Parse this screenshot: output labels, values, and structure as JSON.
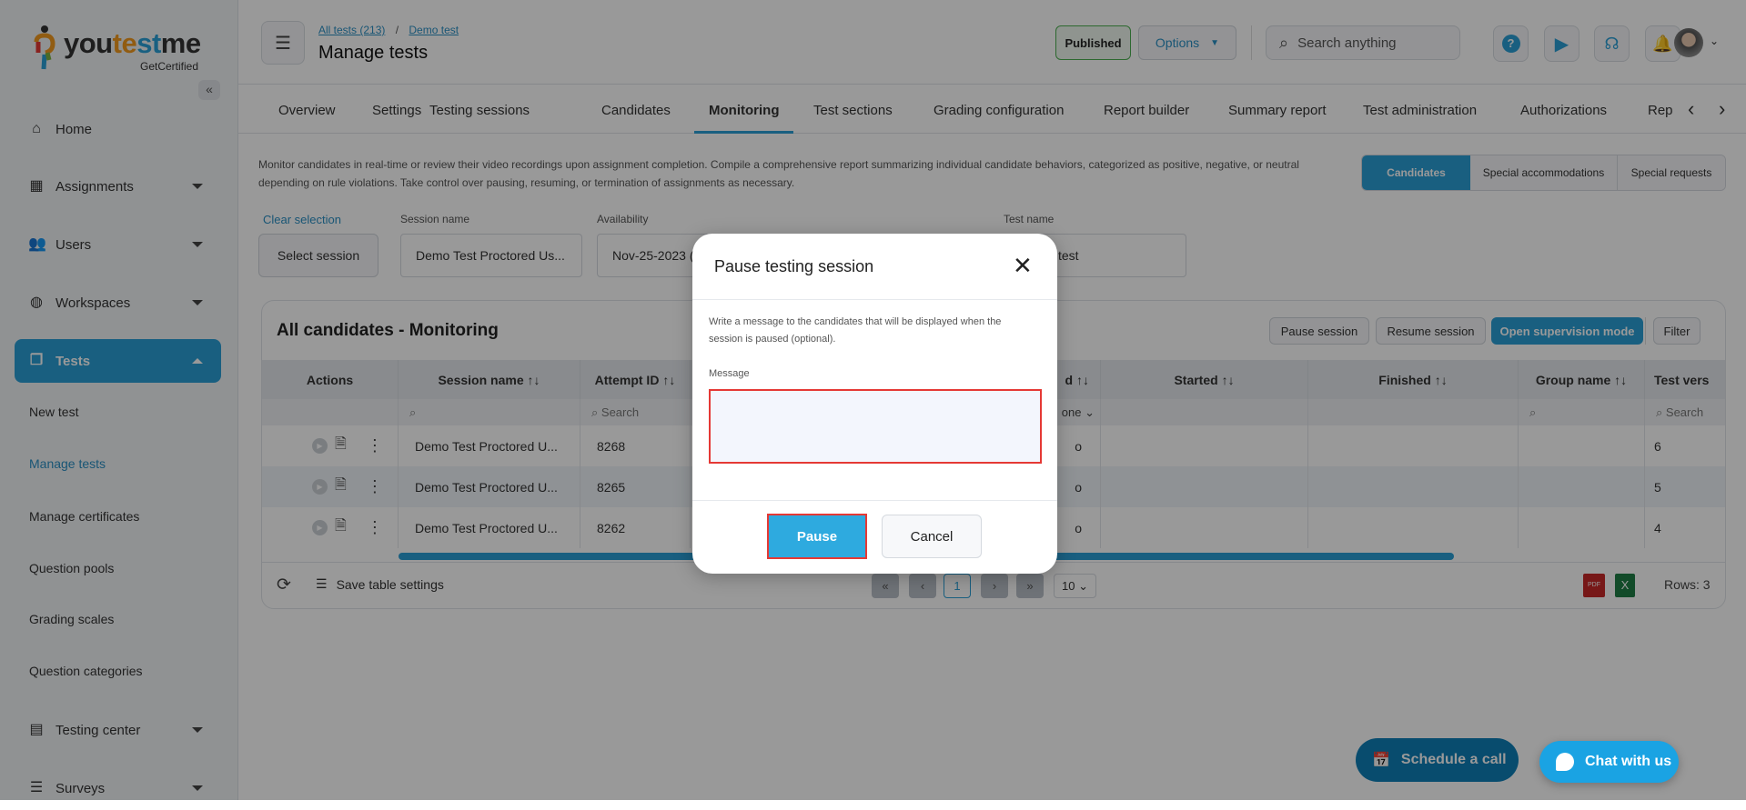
{
  "brand": {
    "name_parts": [
      "you",
      "te",
      "st",
      "me"
    ],
    "tagline": "GetCertified"
  },
  "colors": {
    "primary": "#2b9fd6",
    "published_border": "#4caf50",
    "highlight": "#e53935"
  },
  "sidebar": {
    "collapse_icon": "double-chevron-left-icon",
    "items": [
      {
        "label": "Home",
        "icon": "home-icon"
      },
      {
        "label": "Assignments",
        "icon": "dashboard-icon"
      },
      {
        "label": "Users",
        "icon": "users-icon"
      },
      {
        "label": "Workspaces",
        "icon": "globe-icon"
      },
      {
        "label": "Tests",
        "icon": "copy-icon",
        "active": true
      },
      {
        "label": "Testing center",
        "icon": "calendar-card-icon"
      },
      {
        "label": "Surveys",
        "icon": "list-icon"
      }
    ],
    "tests_sub": [
      "New test",
      "Manage tests",
      "Manage certificates",
      "Question pools",
      "Grading scales",
      "Question categories"
    ],
    "active_sub": "Manage tests"
  },
  "header": {
    "breadcrumb": [
      "All tests (213)",
      "Demo test"
    ],
    "separator": "/",
    "title": "Manage tests",
    "status": "Published",
    "options": "Options",
    "search_placeholder": "Search anything",
    "icons": [
      "help-icon",
      "play-icon",
      "headset-icon",
      "bell-icon"
    ]
  },
  "tabs": [
    "Overview",
    "Settings",
    "Testing sessions",
    "Candidates",
    "Monitoring",
    "Test sections",
    "Grading configuration",
    "Report builder",
    "Summary report",
    "Test administration",
    "Authorizations",
    "Rep"
  ],
  "active_tab": "Monitoring",
  "description": [
    "Monitor candidates in real-time or review their video recordings upon assignment completion. Compile a comprehensive report summarizing individual candidate behaviors, categorized as positive, negative, or neutral",
    "depending on rule violations. Take control over pausing, resuming, or termination of assignments as necessary."
  ],
  "view_toggle": [
    "Candidates",
    "Special accommodations",
    "Special requests"
  ],
  "filters": {
    "clear": "Clear selection",
    "select_session": "Select session",
    "session_label": "Session name",
    "session_value": "Demo Test Proctored Us...",
    "availability_label": "Availability",
    "availability_value": "Nov-25-2023 (",
    "testname_label": "Test name",
    "testname_value": "test"
  },
  "table": {
    "title": "All candidates - Monitoring",
    "buttons": [
      "Pause session",
      "Resume session",
      "Open supervision mode",
      "Filter"
    ],
    "columns": [
      "Actions",
      "Session name",
      "Attempt ID",
      "d",
      "Started",
      "Finished",
      "Group name",
      "Test vers"
    ],
    "search_placeholder": "Search",
    "status_filter": "one",
    "rows": [
      {
        "session": "Demo Test Proctored U...",
        "attempt": "8268",
        "status": "o",
        "version": "6"
      },
      {
        "session": "Demo Test Proctored U...",
        "attempt": "8265",
        "status": "o",
        "version": "5"
      },
      {
        "session": "Demo Test Proctored U...",
        "attempt": "8262",
        "status": "o",
        "version": "4"
      }
    ],
    "footer": {
      "save": "Save table settings",
      "page": "1",
      "per_page": "10",
      "rows": "Rows: 3"
    }
  },
  "modal": {
    "title": "Pause testing session",
    "text": "Write a message to the candidates that will be displayed when the session is paused (optional).",
    "message_label": "Message",
    "message_value": "",
    "pause": "Pause",
    "cancel": "Cancel"
  },
  "floating": {
    "schedule": "Schedule a call",
    "chat": "Chat with us"
  }
}
